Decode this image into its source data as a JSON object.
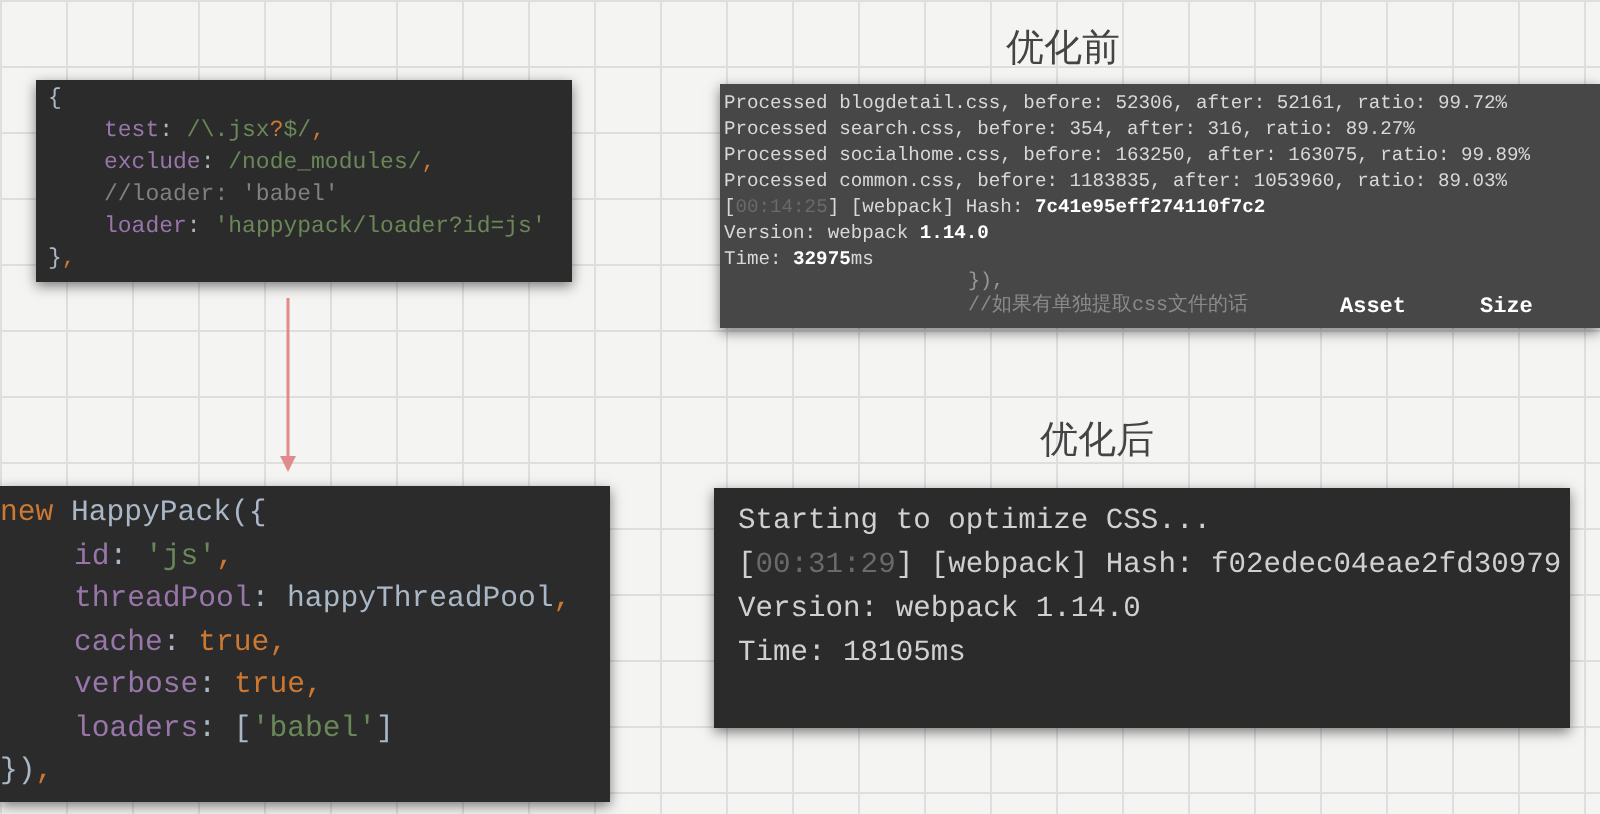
{
  "rule_snippet": {
    "lines": [
      {
        "indent": false,
        "tokens": [
          {
            "t": "{",
            "kind": "plain"
          }
        ]
      },
      {
        "indent": true,
        "tokens": [
          {
            "t": "test",
            "kind": "key"
          },
          {
            "t": ": ",
            "kind": "plain"
          },
          {
            "t": "/\\.jsx",
            "kind": "regex"
          },
          {
            "t": "?",
            "kind": "keyword"
          },
          {
            "t": "$/",
            "kind": "regex"
          },
          {
            "t": ",",
            "kind": "keyword"
          }
        ]
      },
      {
        "indent": true,
        "tokens": [
          {
            "t": "exclude",
            "kind": "key"
          },
          {
            "t": ": ",
            "kind": "plain"
          },
          {
            "t": "/node_modules/",
            "kind": "regex"
          },
          {
            "t": ",",
            "kind": "keyword"
          }
        ]
      },
      {
        "indent": true,
        "tokens": [
          {
            "t": "//loader: 'babel'",
            "kind": "comment"
          }
        ]
      },
      {
        "indent": true,
        "tokens": [
          {
            "t": "loader",
            "kind": "key"
          },
          {
            "t": ": ",
            "kind": "plain"
          },
          {
            "t": "'happypack/loader?id=js'",
            "kind": "string"
          }
        ]
      },
      {
        "indent": false,
        "tokens": [
          {
            "t": "}",
            "kind": "plain"
          },
          {
            "t": ",",
            "kind": "keyword"
          }
        ]
      }
    ]
  },
  "before": {
    "title": "优化前",
    "lines": [
      {
        "tokens": [
          {
            "t": "Processed blogdetail.css, before: 52306, after: 52161, ratio: 99.72%",
            "kind": "normal"
          }
        ]
      },
      {
        "tokens": [
          {
            "t": "Processed search.css, before: 354, after: 316, ratio: 89.27%",
            "kind": "normal"
          }
        ]
      },
      {
        "tokens": [
          {
            "t": "Processed socialhome.css, before: 163250, after: 163075, ratio: 99.89%",
            "kind": "normal"
          }
        ]
      },
      {
        "tokens": [
          {
            "t": "Processed common.css, before: 1183835, after: 1053960, ratio: 89.03%",
            "kind": "normal"
          }
        ]
      },
      {
        "tokens": [
          {
            "t": "[",
            "kind": "normal"
          },
          {
            "t": "00:14:25",
            "kind": "dim"
          },
          {
            "t": "] [webpack] Hash: ",
            "kind": "normal"
          },
          {
            "t": "7c41e95eff274110f7c2",
            "kind": "bright"
          }
        ]
      },
      {
        "tokens": [
          {
            "t": "Version: webpack ",
            "kind": "normal"
          },
          {
            "t": "1.14.0",
            "kind": "bright"
          }
        ]
      },
      {
        "tokens": [
          {
            "t": "Time: ",
            "kind": "normal"
          },
          {
            "t": "32975",
            "kind": "bright"
          },
          {
            "t": "ms",
            "kind": "normal"
          }
        ]
      }
    ],
    "ghost_lines": [
      "}),",
      "//如果有单独提取css文件的话"
    ],
    "columns": [
      "Asset",
      "Size"
    ]
  },
  "happypack_snippet": {
    "lines": [
      {
        "indent": false,
        "tokens": [
          {
            "t": "new ",
            "kind": "keyword"
          },
          {
            "t": "HappyPack({",
            "kind": "plain"
          }
        ]
      },
      {
        "indent": true,
        "tokens": [
          {
            "t": "id",
            "kind": "key"
          },
          {
            "t": ": ",
            "kind": "plain"
          },
          {
            "t": "'js'",
            "kind": "string"
          },
          {
            "t": ",",
            "kind": "keyword"
          }
        ]
      },
      {
        "indent": true,
        "tokens": [
          {
            "t": "threadPool",
            "kind": "key"
          },
          {
            "t": ": happyThreadPool",
            "kind": "plain"
          },
          {
            "t": ",",
            "kind": "keyword"
          }
        ]
      },
      {
        "indent": true,
        "tokens": [
          {
            "t": "cache",
            "kind": "key"
          },
          {
            "t": ": ",
            "kind": "plain"
          },
          {
            "t": "true",
            "kind": "keyword"
          },
          {
            "t": ",",
            "kind": "keyword"
          }
        ]
      },
      {
        "indent": true,
        "tokens": [
          {
            "t": "verbose",
            "kind": "key"
          },
          {
            "t": ": ",
            "kind": "plain"
          },
          {
            "t": "true",
            "kind": "keyword"
          },
          {
            "t": ",",
            "kind": "keyword"
          }
        ]
      },
      {
        "indent": true,
        "tokens": [
          {
            "t": "loaders",
            "kind": "key"
          },
          {
            "t": ": [",
            "kind": "plain"
          },
          {
            "t": "'babel'",
            "kind": "string"
          },
          {
            "t": "]",
            "kind": "plain"
          }
        ]
      },
      {
        "indent": false,
        "tokens": [
          {
            "t": "})",
            "kind": "plain"
          },
          {
            "t": ",",
            "kind": "keyword"
          }
        ]
      }
    ]
  },
  "after": {
    "title": "优化后",
    "lines": [
      {
        "tokens": [
          {
            "t": "Starting to optimize CSS...",
            "kind": "normal"
          }
        ]
      },
      {
        "tokens": [
          {
            "t": "[",
            "kind": "normal"
          },
          {
            "t": "00:31:29",
            "kind": "dim"
          },
          {
            "t": "] [webpack] Hash: f02edec04eae2fd30979",
            "kind": "normal"
          }
        ]
      },
      {
        "tokens": [
          {
            "t": "Version: webpack 1.14.0",
            "kind": "normal"
          }
        ]
      },
      {
        "tokens": [
          {
            "t": "Time: 18105ms",
            "kind": "normal"
          }
        ]
      }
    ]
  }
}
